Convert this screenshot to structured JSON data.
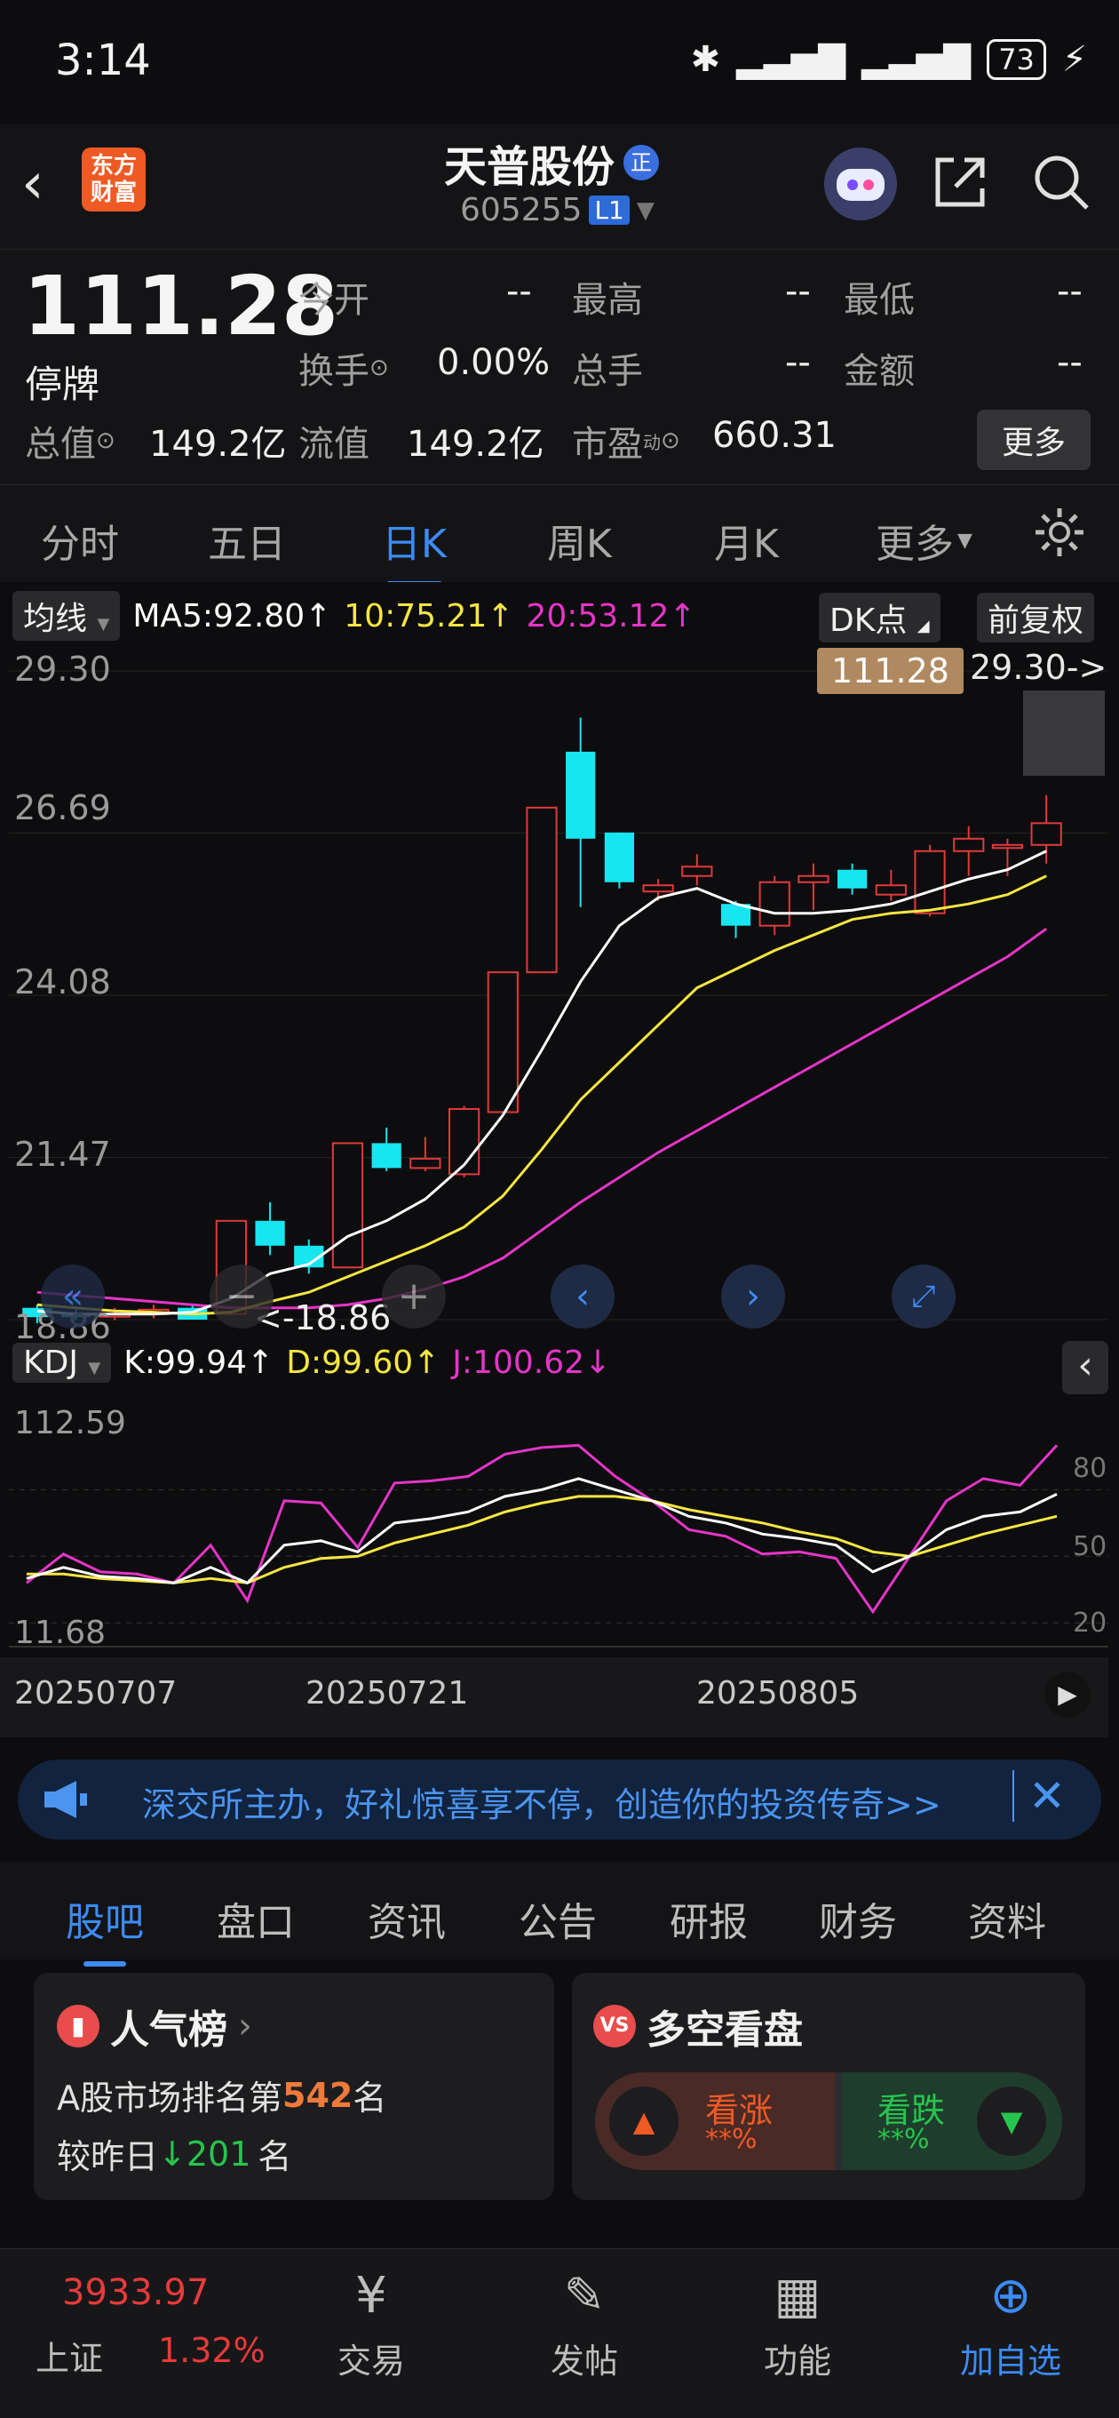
{
  "status_bar": {
    "time": "3:14",
    "battery": "73"
  },
  "header": {
    "logo_text": "东方财富",
    "stock_name": "天普股份",
    "badge": "正",
    "stock_code": "605255",
    "level": "L1"
  },
  "quote": {
    "price": "111.28",
    "state": "停牌",
    "fields": [
      {
        "label": "今开",
        "value": "--"
      },
      {
        "label": "最高",
        "value": "--"
      },
      {
        "label": "最低",
        "value": "--"
      },
      {
        "label": "换手",
        "value": "0.00%"
      },
      {
        "label": "总手",
        "value": "--"
      },
      {
        "label": "金额",
        "value": "--"
      },
      {
        "label": "总值",
        "value": "149.2亿"
      },
      {
        "label": "流值",
        "value": "149.2亿"
      },
      {
        "label": "市盈",
        "value": "660.31"
      }
    ],
    "pe_superscript": "动",
    "more_label": "更多"
  },
  "kline_tabs": [
    "分时",
    "五日",
    "日K",
    "周K",
    "月K",
    "更多"
  ],
  "ma_bar": {
    "selector": "均线",
    "ma5": "MA5:92.80↑",
    "ma10": "10:75.21↑",
    "ma20": "20:53.12↑",
    "dk_label": "DK点",
    "adjust_label": "前复权",
    "colors": {
      "ma5": "#ffffff",
      "ma10": "#f5e642",
      "ma20": "#e535c8",
      "up": "#e03a3a",
      "down": "#17e6f0"
    }
  },
  "main_chart": {
    "y_labels": [
      "29.30",
      "26.69",
      "24.08",
      "21.47",
      "18.86"
    ],
    "price_tag": "111.28",
    "high_marker": "29.30->",
    "low_marker": "<-18.86",
    "candles": [
      {
        "o": 19.05,
        "c": 18.9,
        "h": 19.1,
        "l": 18.8
      },
      {
        "o": 18.95,
        "c": 18.9,
        "h": 19.05,
        "l": 18.85
      },
      {
        "o": 18.92,
        "c": 18.95,
        "h": 19.05,
        "l": 18.85
      },
      {
        "o": 18.95,
        "c": 19.02,
        "h": 19.1,
        "l": 18.88
      },
      {
        "o": 19.05,
        "c": 18.86,
        "h": 19.1,
        "l": 18.86
      },
      {
        "o": 18.95,
        "c": 20.45,
        "h": 20.45,
        "l": 18.95
      },
      {
        "o": 20.45,
        "c": 20.05,
        "h": 20.75,
        "l": 19.9
      },
      {
        "o": 20.05,
        "c": 19.7,
        "h": 20.15,
        "l": 19.6
      },
      {
        "o": 19.7,
        "c": 21.7,
        "h": 21.7,
        "l": 19.7
      },
      {
        "o": 21.7,
        "c": 21.3,
        "h": 21.95,
        "l": 21.25
      },
      {
        "o": 21.3,
        "c": 21.45,
        "h": 21.8,
        "l": 21.25
      },
      {
        "o": 21.2,
        "c": 22.25,
        "h": 22.3,
        "l": 21.15
      },
      {
        "o": 22.2,
        "c": 24.45,
        "h": 24.45,
        "l": 22.2
      },
      {
        "o": 24.45,
        "c": 27.1,
        "h": 27.1,
        "l": 24.45
      },
      {
        "o": 28.0,
        "c": 26.6,
        "h": 28.55,
        "l": 25.5
      },
      {
        "o": 26.7,
        "c": 25.9,
        "h": 26.7,
        "l": 25.8
      },
      {
        "o": 25.75,
        "c": 25.85,
        "h": 25.95,
        "l": 25.6
      },
      {
        "o": 26.0,
        "c": 26.15,
        "h": 26.35,
        "l": 25.85
      },
      {
        "o": 25.55,
        "c": 25.2,
        "h": 25.6,
        "l": 25.0
      },
      {
        "o": 25.2,
        "c": 25.9,
        "h": 26.0,
        "l": 25.05
      },
      {
        "o": 25.9,
        "c": 26.0,
        "h": 26.2,
        "l": 25.45
      },
      {
        "o": 26.1,
        "c": 25.8,
        "h": 26.2,
        "l": 25.7
      },
      {
        "o": 25.7,
        "c": 25.85,
        "h": 26.1,
        "l": 25.6
      },
      {
        "o": 25.4,
        "c": 26.4,
        "h": 26.5,
        "l": 25.35
      },
      {
        "o": 26.4,
        "c": 26.6,
        "h": 26.8,
        "l": 26.0
      },
      {
        "o": 26.45,
        "c": 26.5,
        "h": 26.6,
        "l": 26.0
      },
      {
        "o": 26.5,
        "c": 26.85,
        "h": 27.3,
        "l": 26.2
      }
    ],
    "ma5_line": [
      19.0,
      18.95,
      18.95,
      18.95,
      18.98,
      19.2,
      19.6,
      19.75,
      20.2,
      20.45,
      20.8,
      21.35,
      22.15,
      23.2,
      24.3,
      25.2,
      25.65,
      25.8,
      25.55,
      25.4,
      25.4,
      25.45,
      25.55,
      25.75,
      25.95,
      26.1,
      26.4
    ],
    "ma10_line": [
      19.1,
      19.05,
      19.0,
      18.98,
      18.95,
      18.98,
      19.15,
      19.3,
      19.55,
      19.8,
      20.05,
      20.35,
      20.85,
      21.6,
      22.4,
      23.0,
      23.6,
      24.2,
      24.5,
      24.8,
      25.05,
      25.3,
      25.4,
      25.45,
      25.55,
      25.7,
      26.0
    ],
    "ma20_line": [
      19.3,
      19.25,
      19.2,
      19.15,
      19.1,
      19.05,
      19.05,
      19.05,
      19.1,
      19.2,
      19.35,
      19.55,
      19.85,
      20.3,
      20.75,
      21.15,
      21.55,
      21.9,
      22.25,
      22.6,
      22.95,
      23.3,
      23.65,
      24.0,
      24.35,
      24.7,
      25.15
    ],
    "nav_controls": [
      "rewind",
      "zoom-out",
      "zoom-in",
      "prev",
      "next",
      "expand"
    ]
  },
  "kdj": {
    "selector": "KDJ",
    "k_label": "K:99.94↑",
    "d_label": "D:99.60↑",
    "j_label": "J:100.62↓",
    "y_top": "112.59",
    "y_bottom": "11.68",
    "levels": [
      "80",
      "50",
      "20"
    ],
    "k": [
      40,
      45,
      41,
      40,
      38,
      45,
      38,
      55,
      57,
      52,
      65,
      67,
      70,
      77,
      80,
      85,
      80,
      75,
      68,
      65,
      60,
      58,
      55,
      43,
      50,
      62,
      68,
      70,
      78
    ],
    "d": [
      42,
      42,
      40,
      39,
      38,
      40,
      38,
      45,
      49,
      50,
      56,
      60,
      64,
      70,
      74,
      77,
      77,
      75,
      71,
      68,
      65,
      61,
      58,
      52,
      50,
      55,
      60,
      64,
      68
    ],
    "j": [
      38,
      51,
      43,
      42,
      38,
      55,
      30,
      75,
      74,
      54,
      83,
      84,
      86,
      96,
      99,
      100,
      86,
      75,
      62,
      59,
      51,
      52,
      49,
      25,
      50,
      75,
      85,
      82,
      100
    ],
    "dates": [
      "20250707",
      "20250721",
      "20250805"
    ]
  },
  "promo": {
    "text": "深交所主办，好礼惊喜享不停，创造你的投资传奇>>"
  },
  "content_tabs": [
    "股吧",
    "盘口",
    "资讯",
    "公告",
    "研报",
    "财务",
    "资料"
  ],
  "popularity": {
    "title": "人气榜",
    "rank_prefix": "A股市场排名第",
    "rank": "542",
    "rank_suffix": "名",
    "change_prefix": "较昨日",
    "change_arrow": "↓",
    "change": "201",
    "change_suffix": "名"
  },
  "sentiment": {
    "title": "多空看盘",
    "bull_label": "看涨",
    "bull_pct": "**%",
    "bear_label": "看跌",
    "bear_pct": "**%"
  },
  "bottom_nav": {
    "index_value": "3933.97",
    "index_name": "上证",
    "index_change": "1.32%",
    "items": [
      "交易",
      "发帖",
      "功能",
      "加自选"
    ]
  }
}
